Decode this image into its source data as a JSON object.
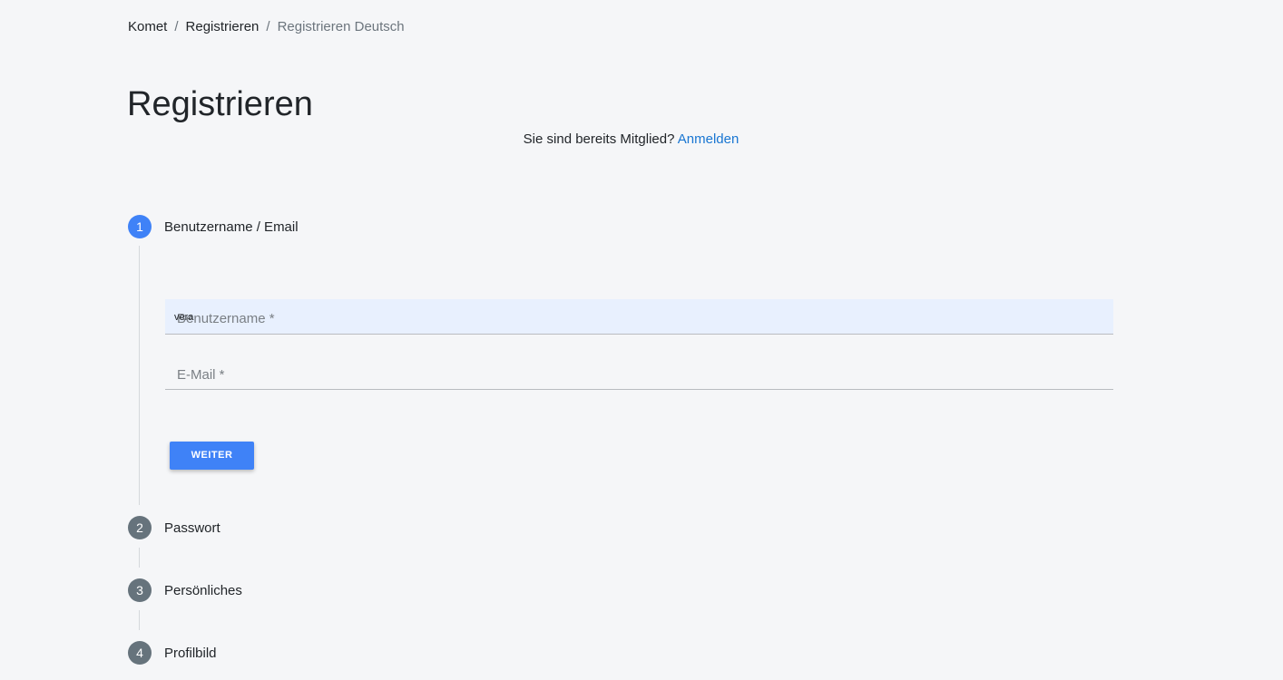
{
  "breadcrumb": {
    "items": [
      "Komet",
      "Registrieren",
      "Registrieren Deutsch"
    ],
    "separator": "/"
  },
  "page_title": "Registrieren",
  "member": {
    "text": "Sie sind bereits Mitglied?",
    "link": "Anmelden"
  },
  "steps": [
    {
      "number": "1",
      "label": "Benutzername / Email",
      "state": "active"
    },
    {
      "number": "2",
      "label": "Passwort",
      "state": "inactive"
    },
    {
      "number": "3",
      "label": "Persönliches",
      "state": "inactive"
    },
    {
      "number": "4",
      "label": "Profilbild",
      "state": "inactive"
    }
  ],
  "form": {
    "username": {
      "value": "vera",
      "placeholder": "Benutzername *"
    },
    "email": {
      "value": "",
      "placeholder": "E-Mail *"
    },
    "next_label": "WEITER"
  },
  "colors": {
    "accent": "#3f82f7",
    "link": "#1976d2",
    "step_inactive": "#66737c",
    "autofill": "#e8f0fe",
    "background": "#f5f6f8"
  }
}
